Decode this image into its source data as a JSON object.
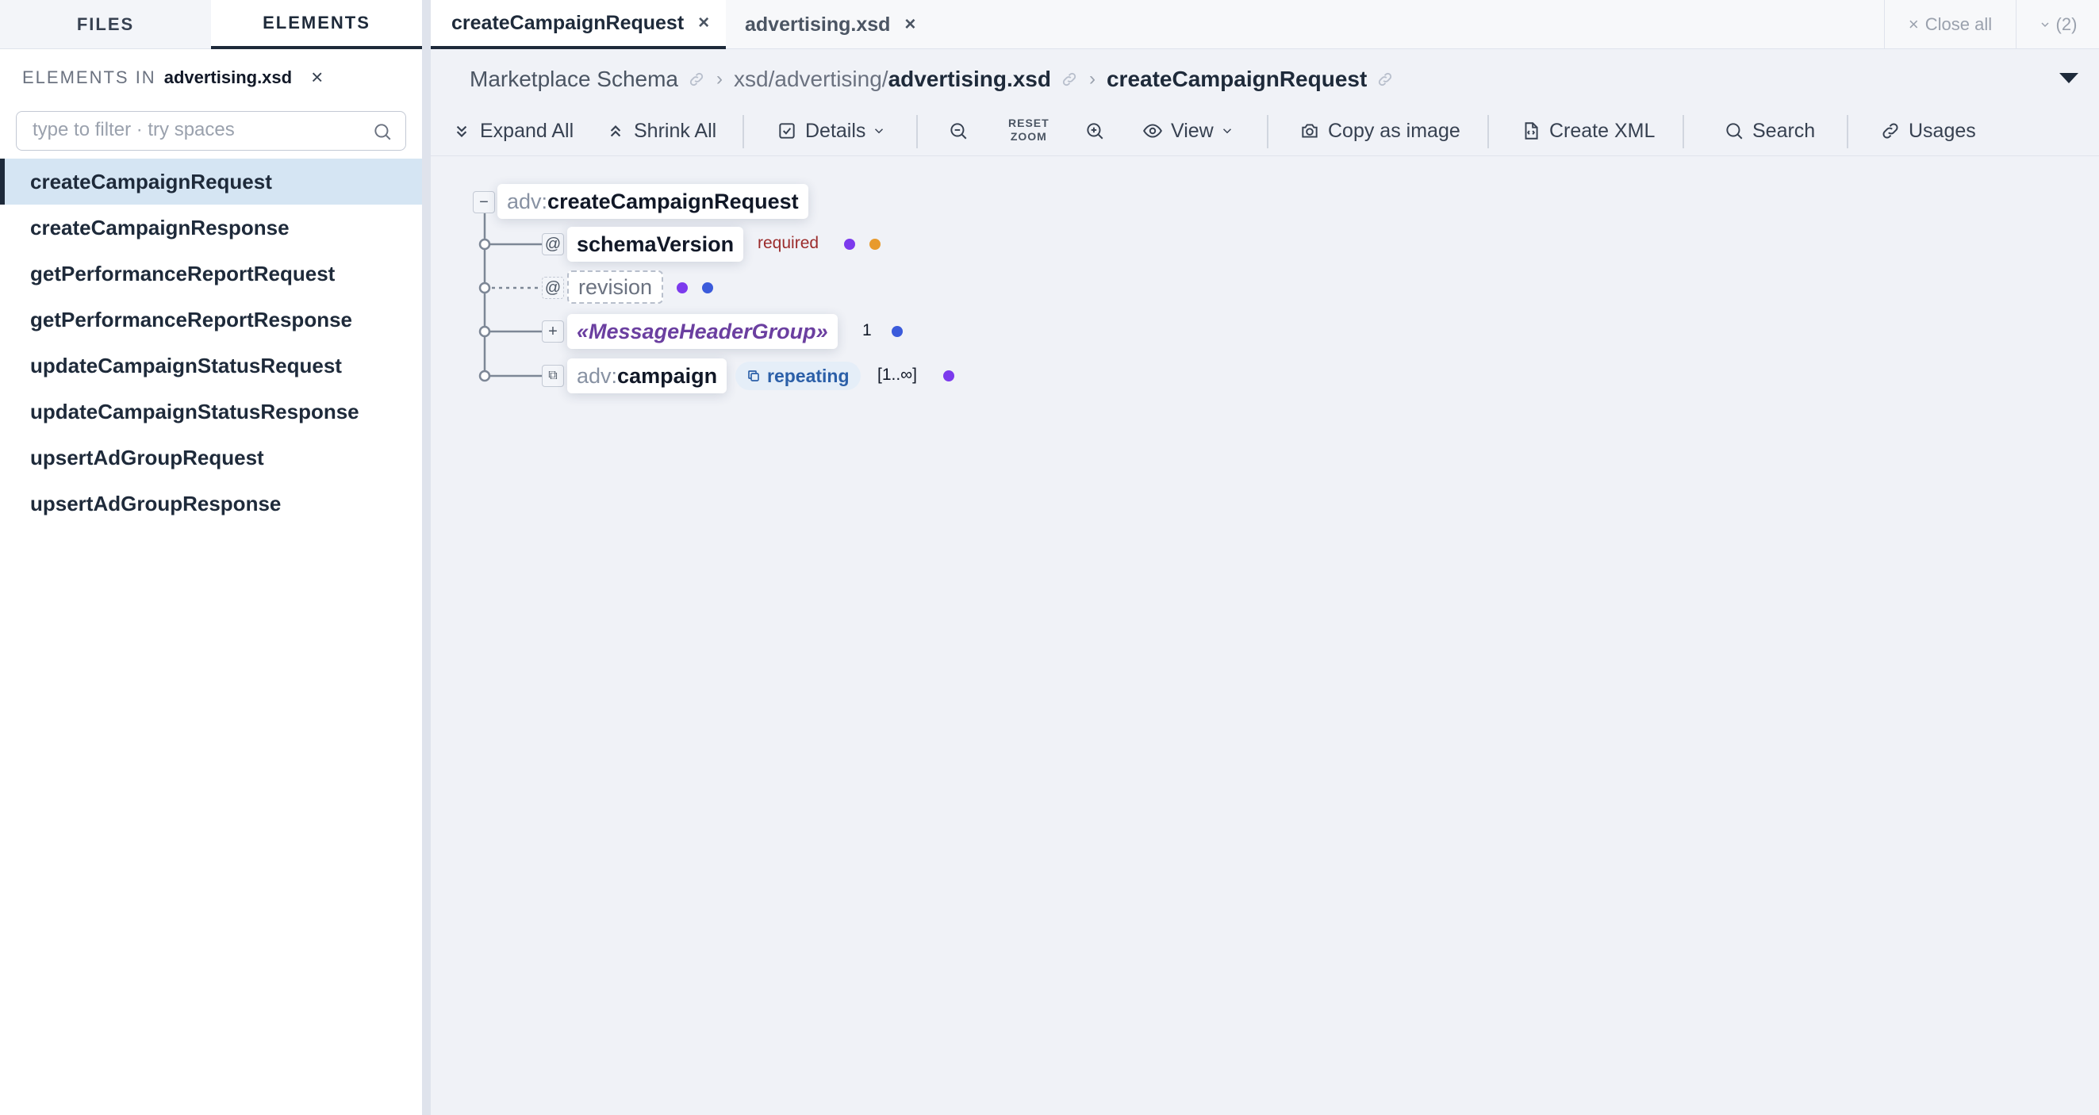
{
  "sidebar": {
    "tabs": [
      {
        "label": "FILES",
        "active": false
      },
      {
        "label": "ELEMENTS",
        "active": true
      }
    ],
    "header_label": "ELEMENTS IN",
    "header_file": "advertising.xsd",
    "clear_icon": "close-icon",
    "filter_placeholder": "type to filter · try spaces",
    "filter_value": "",
    "elements": [
      "createCampaignRequest",
      "createCampaignResponse",
      "getPerformanceReportRequest",
      "getPerformanceReportResponse",
      "updateCampaignStatusRequest",
      "updateCampaignStatusResponse",
      "upsertAdGroupRequest",
      "upsertAdGroupResponse"
    ],
    "selected_index": 0
  },
  "tabs": {
    "items": [
      {
        "label": "createCampaignRequest",
        "active": true
      },
      {
        "label": "advertising.xsd",
        "active": false
      }
    ],
    "close_all_label": "Close all",
    "count_label": "(2)"
  },
  "breadcrumb": {
    "root": "Marketplace Schema",
    "path_prefix": "xsd/advertising/",
    "path_file": "advertising.xsd",
    "current": "createCampaignRequest",
    "separator": "›"
  },
  "toolbar": {
    "expand_all": "Expand All",
    "shrink_all": "Shrink All",
    "details": "Details",
    "reset_zoom_line1": "RESET",
    "reset_zoom_line2": "ZOOM",
    "view": "View",
    "copy_image": "Copy as image",
    "create_xml": "Create XML",
    "search": "Search",
    "usages": "Usages"
  },
  "diagram": {
    "root": {
      "prefix": "adv:",
      "name": "createCampaignRequest",
      "toggle": "−"
    },
    "children": [
      {
        "kind": "attribute",
        "marker": "@",
        "name": "schemaVersion",
        "tag": "required",
        "dots": [
          "#7c3aed",
          "#e89a2c"
        ]
      },
      {
        "kind": "attribute",
        "marker": "@",
        "name": "revision",
        "optional": true,
        "dots": [
          "#7c3aed",
          "#3b5bdb"
        ]
      },
      {
        "kind": "group",
        "marker": "+",
        "name": "«MessageHeaderGroup»",
        "cardinality": "1",
        "dots": [
          "#3b5bdb"
        ]
      },
      {
        "kind": "element",
        "marker": "⧉",
        "prefix": "adv:",
        "name": "campaign",
        "tag": "repeating",
        "cardinality": "[1..∞]",
        "dots": [
          "#7c3aed"
        ]
      }
    ]
  },
  "colors": {
    "accent": "#1e2a3a",
    "selected_bg": "#d5e5f3",
    "required": "#9b2c2c",
    "repeating_bg": "#e5eef8",
    "repeating_fg": "#2b5fa8",
    "group_fg": "#6b3fa0"
  }
}
